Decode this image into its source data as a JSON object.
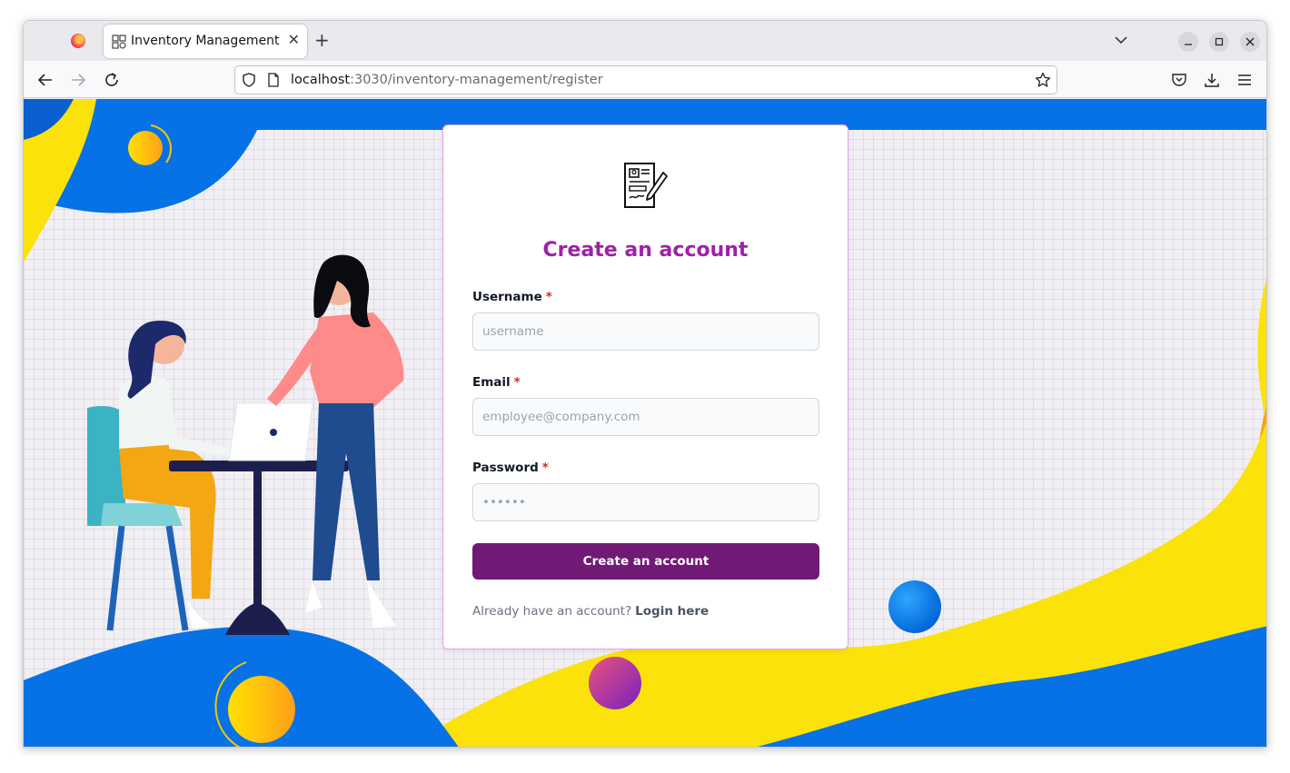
{
  "browser": {
    "tab_title": "Inventory Management",
    "url_host": "localhost",
    "url_rest": ":3030/inventory-management/register",
    "icons": [
      "firefox-icon",
      "tab-close-icon",
      "new-tab-icon",
      "tab-list-icon",
      "minimize-icon",
      "maximize-icon",
      "close-icon",
      "back-icon",
      "forward-icon",
      "reload-icon",
      "shield-icon",
      "page-icon",
      "bookmark-star-icon",
      "pocket-icon",
      "downloads-icon",
      "menu-icon"
    ]
  },
  "form": {
    "title": "Create an account",
    "username_label": "Username",
    "username_placeholder": "username",
    "email_label": "Email",
    "email_placeholder": "employee@company.com",
    "password_label": "Password",
    "password_value": "••••••",
    "required_mark": "*",
    "submit_label": "Create an account",
    "login_prompt": "Already have an account?",
    "login_link": "Login here"
  },
  "colors": {
    "accent": "#701a75",
    "title": "#a020a8",
    "required": "#e02424",
    "blue": "#0672e5",
    "yellow": "#fbe20a"
  }
}
